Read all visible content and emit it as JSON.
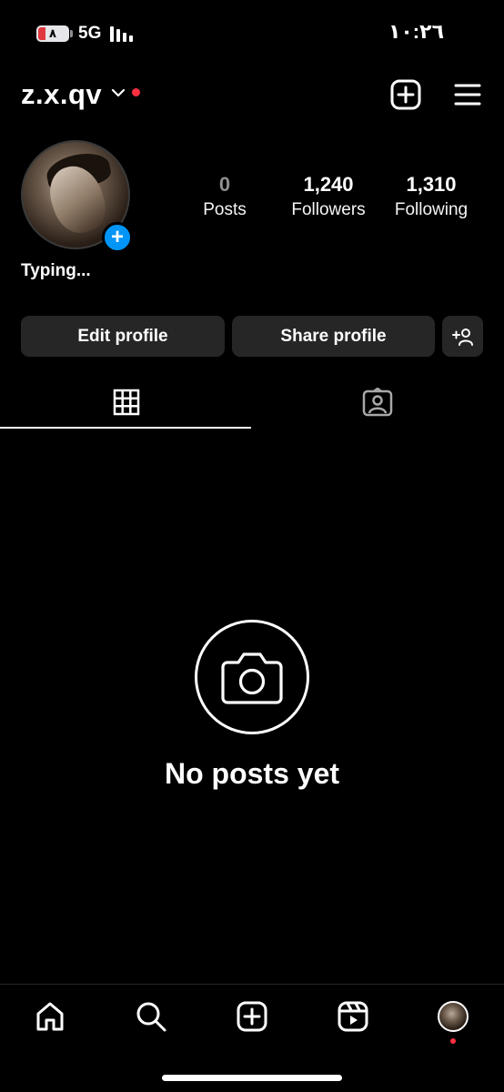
{
  "status_bar": {
    "battery": "٨",
    "network": "5G",
    "time": "١٠:٢٦"
  },
  "header": {
    "username": "z.x.qv",
    "create_icon": "plus-square-icon",
    "menu_icon": "hamburger-menu-icon"
  },
  "profile": {
    "note": "Typing...",
    "stats": [
      {
        "value": "0",
        "label": "Posts"
      },
      {
        "value": "1,240",
        "label": "Followers"
      },
      {
        "value": "1,310",
        "label": "Following"
      }
    ]
  },
  "actions": {
    "edit": "Edit profile",
    "share": "Share profile",
    "discover_icon": "add-person-icon"
  },
  "tabs": [
    {
      "icon": "grid-icon",
      "selected": true
    },
    {
      "icon": "tagged-icon",
      "selected": false
    }
  ],
  "empty_state": {
    "icon": "camera-icon",
    "text": "No posts yet"
  },
  "bottom_nav": [
    {
      "icon": "home-icon"
    },
    {
      "icon": "search-icon"
    },
    {
      "icon": "create-icon"
    },
    {
      "icon": "reels-icon"
    },
    {
      "icon": "profile-avatar"
    }
  ],
  "colors": {
    "background": "#000000",
    "button": "#262626",
    "accent_blue": "#0095f6",
    "notification_red": "#ff3040"
  }
}
